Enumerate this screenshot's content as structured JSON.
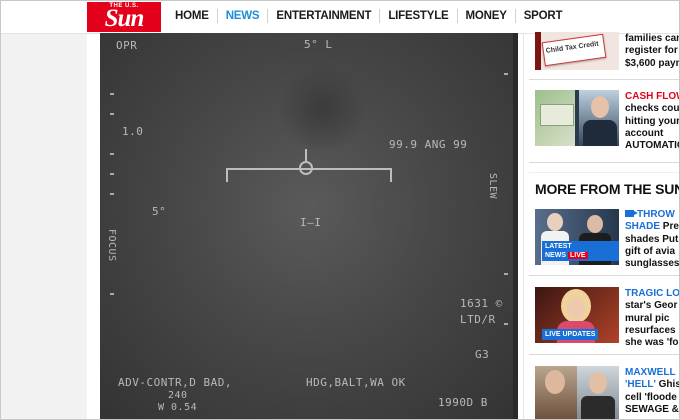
{
  "header": {
    "logo_small": "THE U.S.",
    "logo_big": "Sun",
    "nav": [
      "HOME",
      "NEWS",
      "ENTERTAINMENT",
      "LIFESTYLE",
      "MONEY",
      "SPORT"
    ],
    "active_nav": "NEWS"
  },
  "video": {
    "hud": {
      "top_left": "OPR",
      "top_center": "5° L",
      "left_scale": "1.0",
      "right_readout": "99.9 ANG 99",
      "mid_left": "5°",
      "mid_center": "I—I",
      "right_num": "1631 ©",
      "right_sub": "LTD/R",
      "right_g": "G3",
      "bottom_left": "ADV-CONTR,D BAD,",
      "bottom_left_sub": "240",
      "bottom_left_sub2": "W 0.54",
      "bottom_center": "HDG,BALT,WA OK",
      "bottom_right": "1990D B",
      "left_vertical": "FOCUS",
      "right_vertical": "SLEW"
    }
  },
  "sidebar": {
    "top_stories": [
      {
        "lines": [
          "families can",
          "register for ch",
          "$3,600 paym"
        ],
        "thumb_label": "Child Tax Credit"
      },
      {
        "kicker": "CASH FLOW",
        "lines": [
          "checks could",
          "hitting your",
          "account",
          "AUTOMATICA"
        ]
      }
    ],
    "section_title": "MORE FROM THE SUN",
    "more_stories": [
      {
        "kicker": "THROW",
        "kicker2": "SHADE",
        "lines": [
          " Pre",
          "shades Put",
          "gift of avia",
          "sunglasses"
        ],
        "badge": "LATEST NEWS",
        "badge_live": "LIVE"
      },
      {
        "kicker": "TRAGIC LOS",
        "lines": [
          "star's Geor",
          "mural pic",
          "resurfaces",
          "she was 'fo"
        ],
        "badge": "LIVE UPDATES"
      },
      {
        "kicker": "MAXWELL",
        "kicker2": "'HELL'",
        "lines": [
          " Ghisl",
          "cell 'floode",
          "SEWAGE &"
        ]
      }
    ]
  }
}
